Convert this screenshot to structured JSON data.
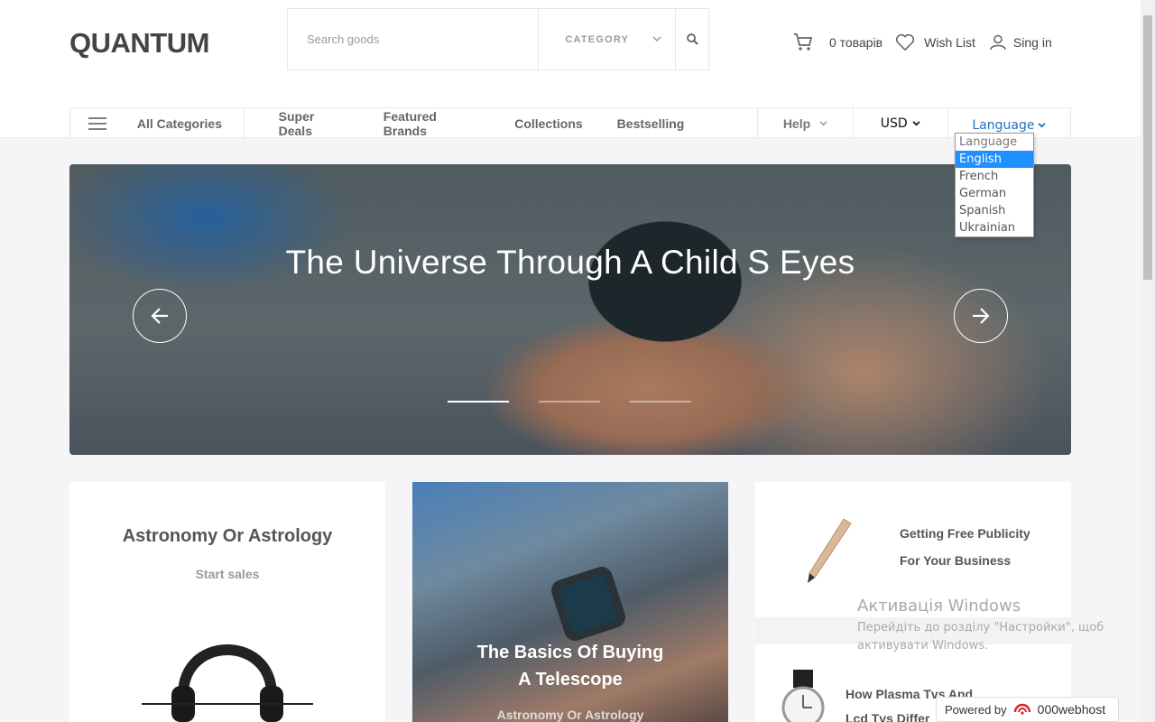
{
  "header": {
    "logo": "QUANTUM",
    "search": {
      "placeholder": "Search goods",
      "category_label": "CATEGORY"
    },
    "cart_label": "0 товарів",
    "wishlist_label": "Wish List",
    "signin_label": "Sing in"
  },
  "nav": {
    "all_categories": "All Categories",
    "links": [
      "Super Deals",
      "Featured Brands",
      "Collections",
      "Bestselling"
    ],
    "help": "Help",
    "currency": "USD",
    "language": "Language"
  },
  "language_dropdown": {
    "options": [
      "Language",
      "English",
      "French",
      "German",
      "Spanish",
      "Ukrainian"
    ],
    "selected": "English"
  },
  "slider": {
    "title": "The Universe Through A Child S Eyes",
    "dot_count": 3,
    "active_dot": 0
  },
  "cards": {
    "card1": {
      "title": "Astronomy Or Astrology",
      "subtitle": "Start sales"
    },
    "card2": {
      "title_line1": "The Basics Of Buying",
      "title_line2": "A Telescope",
      "subtitle": "Astronomy Or Astrology"
    },
    "card3": {
      "item1_line1": "Getting Free Publicity",
      "item1_line2": "For Your Business",
      "item2_line1": "How Plasma Tvs And",
      "item2_line2": "Lcd Tvs Differ"
    }
  },
  "windows_activation": {
    "title": "Активація Windows",
    "line1": "Перейдіть до розділу \"Настройки\", щоб",
    "line2": "активувати Windows."
  },
  "powered_by": {
    "label": "Powered by",
    "brand": "000webhost"
  },
  "colors": {
    "accent_blue": "#1e73be",
    "selection_blue": "#1e90ff",
    "logo": "#444444"
  }
}
